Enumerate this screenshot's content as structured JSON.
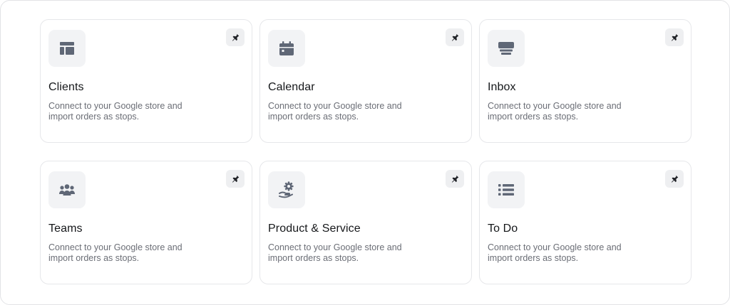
{
  "cards": [
    {
      "title": "Clients",
      "description": "Connect to your Google store and import orders as stops.",
      "icon": "layout-icon"
    },
    {
      "title": "Calendar",
      "description": "Connect to your Google store and import orders as stops.",
      "icon": "calendar-icon"
    },
    {
      "title": "Inbox",
      "description": "Connect to your Google store and import orders as stops.",
      "icon": "inbox-icon"
    },
    {
      "title": "Teams",
      "description": "Connect to your Google store and import orders as stops.",
      "icon": "users-icon"
    },
    {
      "title": "Product & Service",
      "description": "Connect to your Google store and import orders as stops.",
      "icon": "hand-gear-icon"
    },
    {
      "title": "To Do",
      "description": "Connect to your Google store and import orders as stops.",
      "icon": "list-icon"
    }
  ],
  "colors": {
    "icon": "#5f6776",
    "pin": "#1f2126",
    "title": "#15171a",
    "description": "#6b6e76"
  }
}
